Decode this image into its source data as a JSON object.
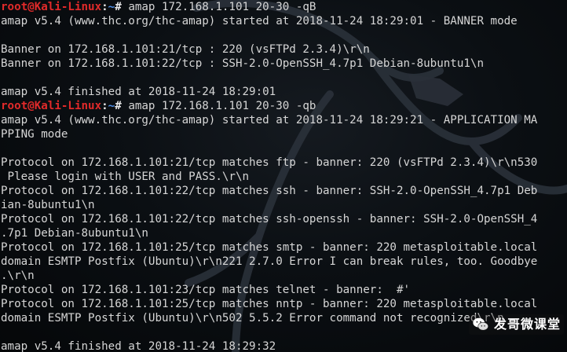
{
  "terminal": {
    "lines": [
      {
        "type": "prompt",
        "user": "root@Kali-Linux",
        "sep": ":",
        "cwd": "~",
        "char": "# ",
        "cmd": "amap 172.168.1.101 20-30 -qB"
      },
      {
        "type": "text",
        "text": "amap v5.4 (www.thc.org/thc-amap) started at 2018-11-24 18:29:01 - BANNER mode"
      },
      {
        "type": "text",
        "text": ""
      },
      {
        "type": "text",
        "text": "Banner on 172.168.1.101:21/tcp : 220 (vsFTPd 2.3.4)\\r\\n"
      },
      {
        "type": "text",
        "text": "Banner on 172.168.1.101:22/tcp : SSH-2.0-OpenSSH_4.7p1 Debian-8ubuntu1\\n"
      },
      {
        "type": "text",
        "text": ""
      },
      {
        "type": "text",
        "text": "amap v5.4 finished at 2018-11-24 18:29:01"
      },
      {
        "type": "prompt",
        "user": "root@Kali-Linux",
        "sep": ":",
        "cwd": "~",
        "char": "# ",
        "cmd": "amap 172.168.1.101 20-30 -qb"
      },
      {
        "type": "text",
        "text": "amap v5.4 (www.thc.org/thc-amap) started at 2018-11-24 18:29:21 - APPLICATION MA"
      },
      {
        "type": "text",
        "text": "PPING mode"
      },
      {
        "type": "text",
        "text": ""
      },
      {
        "type": "text",
        "text": "Protocol on 172.168.1.101:21/tcp matches ftp - banner: 220 (vsFTPd 2.3.4)\\r\\n530"
      },
      {
        "type": "text",
        "text": " Please login with USER and PASS.\\r\\n"
      },
      {
        "type": "text",
        "text": "Protocol on 172.168.1.101:22/tcp matches ssh - banner: SSH-2.0-OpenSSH_4.7p1 Deb"
      },
      {
        "type": "text",
        "text": "ian-8ubuntu1\\n"
      },
      {
        "type": "text",
        "text": "Protocol on 172.168.1.101:22/tcp matches ssh-openssh - banner: SSH-2.0-OpenSSH_4"
      },
      {
        "type": "text",
        "text": ".7p1 Debian-8ubuntu1\\n"
      },
      {
        "type": "text",
        "text": "Protocol on 172.168.1.101:25/tcp matches smtp - banner: 220 metasploitable.local"
      },
      {
        "type": "text",
        "text": "domain ESMTP Postfix (Ubuntu)\\r\\n221 2.7.0 Error I can break rules, too. Goodbye"
      },
      {
        "type": "text",
        "text": ".\\r\\n"
      },
      {
        "type": "text",
        "text": "Protocol on 172.168.1.101:23/tcp matches telnet - banner:  #'"
      },
      {
        "type": "text",
        "text": "Protocol on 172.168.1.101:25/tcp matches nntp - banner: 220 metasploitable.local"
      },
      {
        "type": "text",
        "text": "domain ESMTP Postfix (Ubuntu)\\r\\n502 5.5.2 Error command not recognized\\r\\n"
      },
      {
        "type": "text",
        "text": ""
      },
      {
        "type": "text",
        "text": "amap v5.4 finished at 2018-11-24 18:29:32"
      }
    ]
  },
  "watermark": {
    "text": "发哥微课堂",
    "icon": "wechat-icon"
  },
  "colors": {
    "background": "#0b0f13",
    "text": "#d6d6d6",
    "user": "#e02a2a",
    "cwd": "#4f8fe8",
    "dragon": "#2a3038"
  }
}
